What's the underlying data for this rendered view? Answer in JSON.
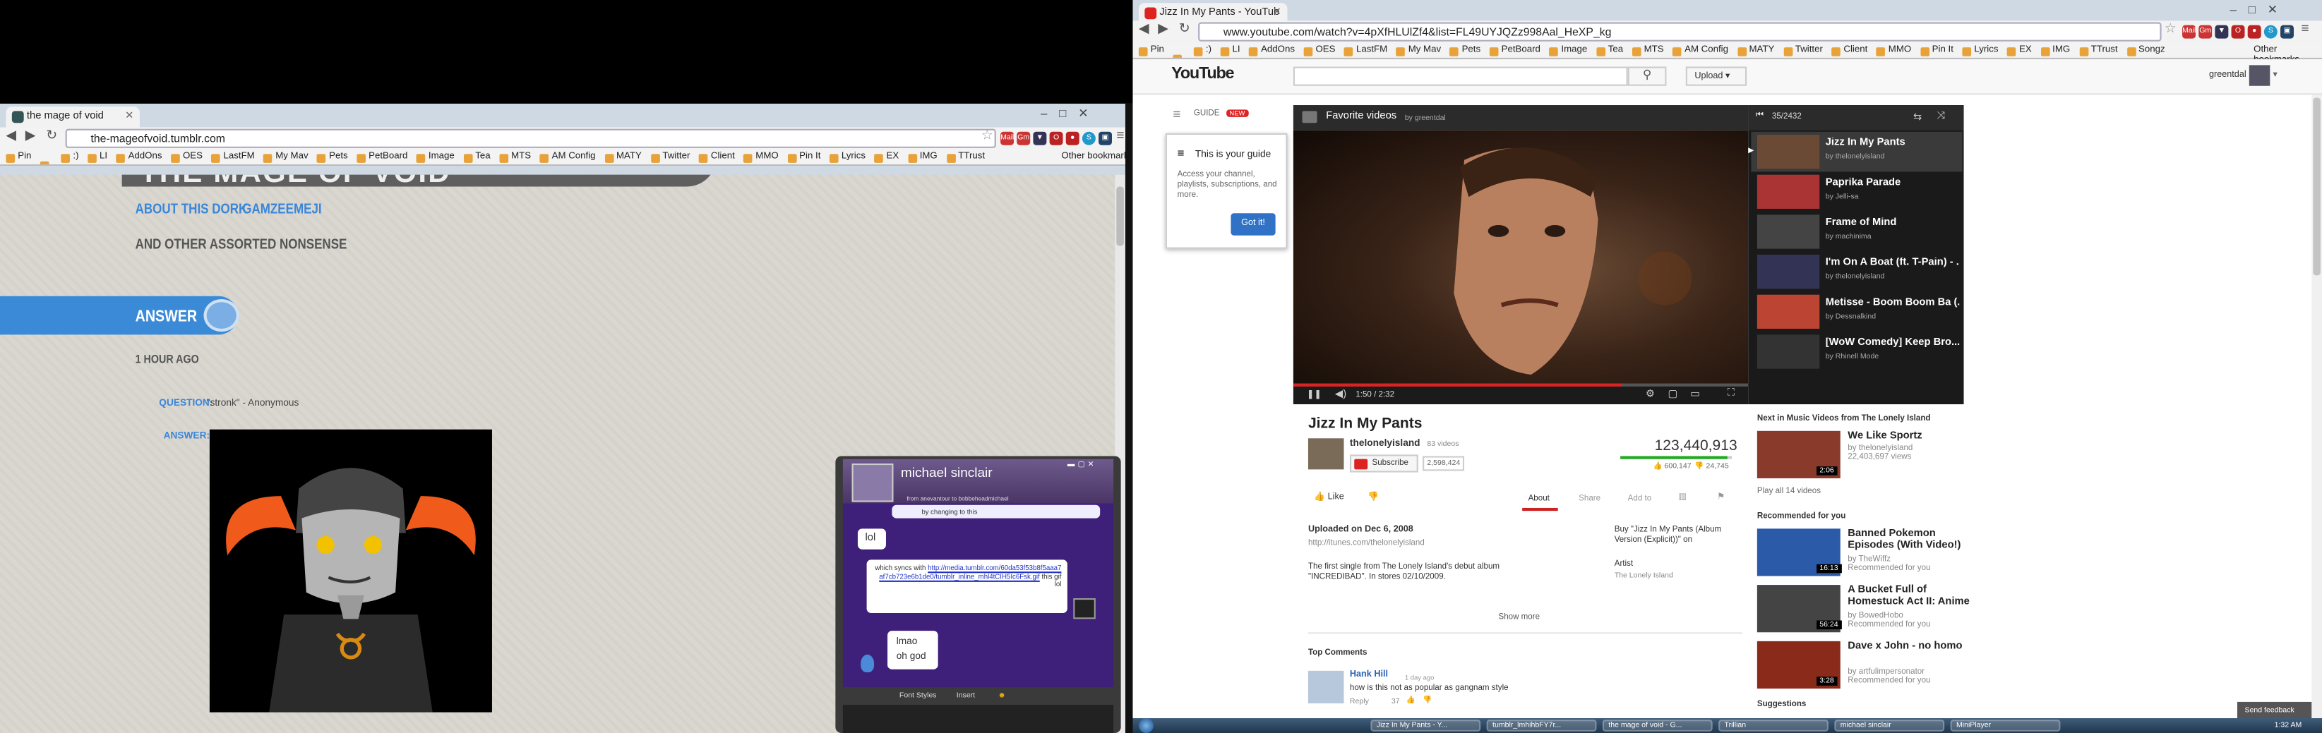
{
  "left": {
    "tab_title": "the mage of void",
    "url": "the-mageofvoid.tumblr.com",
    "bookmarks": [
      "Pin",
      "",
      ":)",
      "LI",
      "AddOns",
      "OES",
      "LastFM",
      "My Mav",
      "Pets",
      "PetBoard",
      "Image",
      "Tea",
      "MTS",
      "AM Config",
      "MATY",
      "Twitter",
      "Client",
      "MMO",
      "Pin It",
      "Lyrics",
      "EX",
      "IMG",
      "TTrust"
    ],
    "other_bookmarks": "Other bookmarks",
    "blog": {
      "title_fragment": "THE MAGE OF VOID",
      "nav_about": "ABOUT THIS DORK",
      "nav_gamzee": "GAMZEEMEJI",
      "tagline": "AND OTHER ASSORTED NONSENSE",
      "post_type": "ANSWER",
      "time_ago": "1 HOUR AGO",
      "question_label": "QUESTION:",
      "question_text": "\"stronk\" - Anonymous",
      "answer_label": "ANSWER:"
    },
    "chat": {
      "name": "michael sinclair",
      "from_line": "from anevantour to bobbeheadmichael",
      "top_line": "by changing to this",
      "msg1": "lol",
      "msg2_pre": "which syncs with ",
      "msg2_link": "http://media.tumblr.com/60da53f53b8f5aaa7af7cb723e6b1de0/tumblr_inline_mhl4tCIH5Ic6Fsk.gif",
      "msg2_post": " this gif",
      "msg2_lol": "lol",
      "msg3_line1": "lmao",
      "msg3_line2": "oh god",
      "font_styles": "Font Styles",
      "insert": "Insert"
    }
  },
  "right": {
    "tab_title": "Jizz In My Pants - YouTub",
    "url": "www.youtube.com/watch?v=4pXfHLUlZf4&list=FL49UYJQZz998Aal_HeXP_kg",
    "bookmarks": [
      "Pin",
      "",
      ":)",
      "LI",
      "AddOns",
      "OES",
      "LastFM",
      "My Mav",
      "Pets",
      "PetBoard",
      "Image",
      "Tea",
      "MTS",
      "AM Config",
      "MATY",
      "Twitter",
      "Client",
      "MMO",
      "Pin It",
      "Lyrics",
      "EX",
      "IMG",
      "TTrust",
      "Songz"
    ],
    "other_bookmarks": "Other bookmarks",
    "yt": {
      "logo": "YouTube",
      "upload": "Upload",
      "user": "greentdal",
      "guide": "GUIDE",
      "guide_new": "NEW",
      "guide_title": "This is your guide",
      "guide_text": "Access your channel, playlists, subscriptions, and more.",
      "got_it": "Got it!",
      "playlist_title": "Favorite videos",
      "playlist_by": "by greentdal",
      "playlist_count": "35/2432",
      "time": "1:50 / 2:32",
      "video_title": "Jizz In My Pants",
      "channel": "thelonelyisland",
      "channel_videos": "83 videos",
      "subscribe": "Subscribe",
      "subs_count": "2,598,424",
      "views": "123,440,913",
      "likes": "600,147",
      "dislikes": "24,745",
      "like": "Like",
      "tab_about": "About",
      "tab_share": "Share",
      "tab_addto": "Add to",
      "uploaded": "Uploaded on Dec 6, 2008",
      "itunes": "http://itunes.com/thelonelyisland",
      "desc": "The first single from The Lonely Island's debut album \"INCREDIBAD\". In stores 02/10/2009.",
      "buy": "Buy \"Jizz In My Pants (Album Version (Explicit))\" on",
      "artist_label": "Artist",
      "artist": "The Lonely Island",
      "show_more": "Show more",
      "top_comments": "Top Comments",
      "comment_user": "Hank Hill",
      "comment_time": "1 day ago",
      "comment_text": "how is this not as popular as gangnam style",
      "comment_reply": "Reply",
      "comment_likes": "37",
      "playlist": [
        {
          "title": "Jizz In My Pants",
          "by": "by thelonelyisland"
        },
        {
          "title": "Paprika Parade",
          "by": "by Jelli-sa"
        },
        {
          "title": "Frame of Mind",
          "by": "by machinima"
        },
        {
          "title": "I'm On A Boat (ft. T-Pain) - ...",
          "by": "by thelonelyisland"
        },
        {
          "title": "Metisse - Boom Boom Ba (...",
          "by": "by Dessnalkind"
        },
        {
          "title": "[WoW Comedy] Keep Bro...",
          "by": "by Rhinell Mode"
        }
      ],
      "next_header": "Next in Music Videos from The Lonely Island",
      "next": {
        "title": "We Like Sportz",
        "by": "by thelonelyisland",
        "views": "22,403,697 views",
        "dur": "2:06"
      },
      "play_all": "Play all 14 videos",
      "recommended_header": "Recommended for you",
      "recs": [
        {
          "title": "Banned Pokemon Episodes (With Video!)",
          "by": "by TheWiffz",
          "rec": "Recommended for you",
          "dur": "16:13"
        },
        {
          "title": "A Bucket Full of Homestuck Act II: Anime",
          "by": "by BowedHobo",
          "rec": "Recommended for you",
          "dur": "56:24"
        },
        {
          "title": "Dave x John - no homo",
          "by": "by artfulimpersonator",
          "rec": "Recommended for you",
          "dur": "3:28"
        }
      ],
      "suggestions": "Suggestions",
      "send_feedback": "Send feedback"
    },
    "taskbar": {
      "items": [
        "Jizz In My Pants - Y...",
        "tumblr_lmhihbFY7r...",
        "the mage of void - G...",
        "Trillian",
        "michael sinclair",
        "MiniPlayer"
      ],
      "clock": "1:32 AM"
    }
  }
}
